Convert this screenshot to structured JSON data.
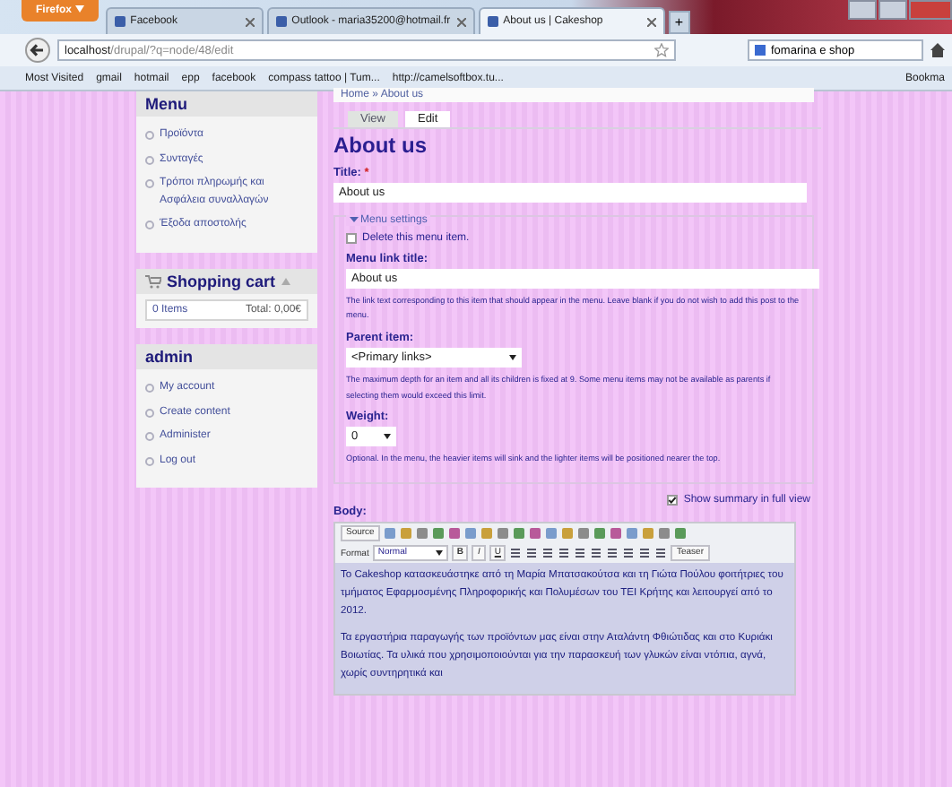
{
  "browser": {
    "menu_button": "Firefox",
    "tabs": [
      {
        "label": "Facebook",
        "selected": false
      },
      {
        "label": "Outlook - maria35200@hotmail.fr",
        "selected": false
      },
      {
        "label": "About us | Cakeshop",
        "selected": true
      }
    ],
    "new_tab": "+",
    "url_host": "localhost",
    "url_path": "/drupal/?q=node/48/edit",
    "search": "fomarina e shop",
    "bookmarks": [
      "Most Visited",
      "gmail",
      "hotmail",
      "epp",
      "facebook",
      "compass tattoo | Tum...",
      "http://camelsoftbox.tu..."
    ],
    "bookmarks_menu": "Bookma"
  },
  "sidebar": {
    "blocks": [
      {
        "kind": "menu",
        "title": "Menu",
        "items": [
          "Προϊόντα",
          "Συνταγές",
          "Τρόποι πληρωμής και Ασφάλεια συναλλαγών",
          "Έξοδα αποστολής"
        ]
      },
      {
        "kind": "cart",
        "title": "Shopping cart",
        "items_count": "0 Items",
        "total": "Total: 0,00€"
      },
      {
        "kind": "menu",
        "title": "admin",
        "items": [
          "My account",
          "Create content",
          "Administer",
          "Log out"
        ]
      }
    ]
  },
  "breadcrumb": "Home » About us",
  "tabs": [
    {
      "label": "View",
      "selected": false
    },
    {
      "label": "Edit",
      "selected": true
    }
  ],
  "page_title": "About us",
  "title_field": {
    "label": "Title:",
    "required_mark": "*",
    "value": "About us"
  },
  "menu_settings": {
    "legend": "Menu settings",
    "expanded": true,
    "delete_item": {
      "label": "Delete this menu item.",
      "checked": false
    },
    "link_title": {
      "label": "Menu link title:",
      "value": "About us",
      "description": "The link text corresponding to this item that should appear in the menu. Leave blank if you do not wish to add this post to the menu."
    },
    "parent": {
      "label": "Parent item:",
      "value": "<Primary links>",
      "description": "The maximum depth for an item and all its children is fixed at 9. Some menu items may not be available as parents if selecting them would exceed this limit."
    },
    "weight": {
      "label": "Weight:",
      "value": "0",
      "description": "Optional. In the menu, the heavier items will sink and the lighter items will be positioned nearer the top."
    }
  },
  "summary": {
    "label": "Show summary in full view",
    "checked": true
  },
  "body": {
    "label": "Body:",
    "source_button": "Source",
    "format_label": "Format",
    "format_value": "Normal",
    "bold": "B",
    "italic": "I",
    "underline": "U",
    "teaser_button": "Teaser",
    "paragraphs": [
      "Το Cakeshop κατασκευάστηκε από τη Μαρία Μπατσακούτσα και τη Γιώτα Πούλου φοιτήτριες του τμήματος Εφαρμοσμένης Πληροφορικής και Πολυμέσων του ΤΕΙ Κρήτης και λειτουργεί από το 2012.",
      "Τα εργαστήρια παραγωγής των προϊόντων μας είναι στην Αταλάντη Φθιώτιδας και στο Κυριάκι Βοιωτίας. Τα υλικά που χρησιμοποιούνται για την παρασκευή των γλυκών είναι ντόπια, αγνά, χωρίς συντηρητικά και"
    ]
  }
}
